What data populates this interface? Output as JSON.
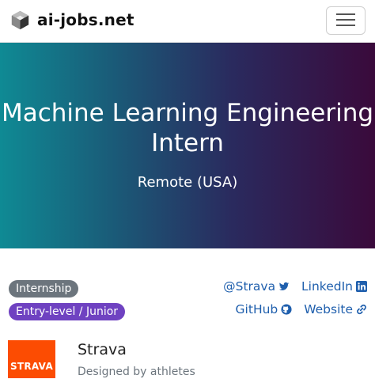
{
  "nav": {
    "brand": "ai-jobs.net",
    "menu_icon": "hamburger-icon"
  },
  "hero": {
    "title": "Machine Learning Engineering Intern",
    "location": "Remote (USA)",
    "gradient": [
      "#0f8a94",
      "#1a5b78",
      "#2a2a5e",
      "#3a0a3b"
    ]
  },
  "badges": {
    "type": "Internship",
    "level": "Entry-level / Junior",
    "type_color": "#6c757d",
    "level_color": "#6f42c1"
  },
  "links": {
    "twitter": "@Strava",
    "linkedin": "LinkedIn",
    "github": "GitHub",
    "website": "Website",
    "color": "#1f5fad"
  },
  "company": {
    "logo_text": "STRAVA",
    "logo_color": "#fc4c02",
    "name": "Strava",
    "tagline": "Designed by athletes"
  }
}
